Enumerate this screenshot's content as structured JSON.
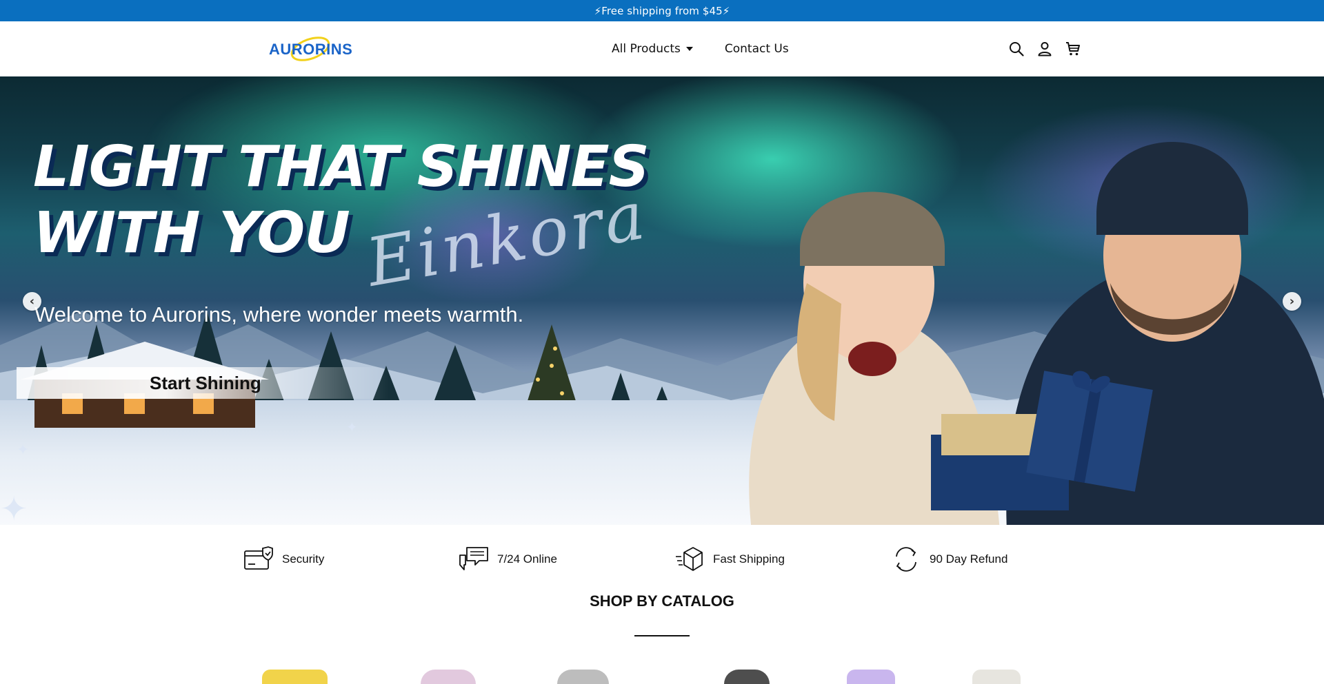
{
  "announcement": {
    "text": "⚡Free shipping from $45⚡"
  },
  "header": {
    "logo_text": "AURORINS",
    "nav": [
      {
        "label": "All Products",
        "has_dropdown": true
      },
      {
        "label": "Contact Us",
        "has_dropdown": false
      }
    ],
    "icons": [
      "search-icon",
      "account-icon",
      "cart-icon"
    ]
  },
  "hero": {
    "headline_line1": "LIGHT THAT SHINES",
    "headline_line2": "WITH YOU",
    "script_text": "Einkora",
    "tagline": "Welcome to Aurorins, where wonder meets warmth.",
    "cta_label": "Start Shining",
    "arrows": [
      "chevron-left-icon",
      "chevron-right-icon"
    ]
  },
  "features": [
    {
      "label": "Security",
      "icon": "secure-card-icon"
    },
    {
      "label": "7/24 Online",
      "icon": "chat-icon"
    },
    {
      "label": "Fast Shipping",
      "icon": "package-icon"
    },
    {
      "label": "90 Day Refund",
      "icon": "refund-cycle-icon"
    }
  ],
  "catalog": {
    "title": "SHOP BY CATALOG"
  },
  "colors": {
    "announcement_bg": "#0a6fbf",
    "brand_blue": "#1a64c8",
    "text": "#111111"
  }
}
